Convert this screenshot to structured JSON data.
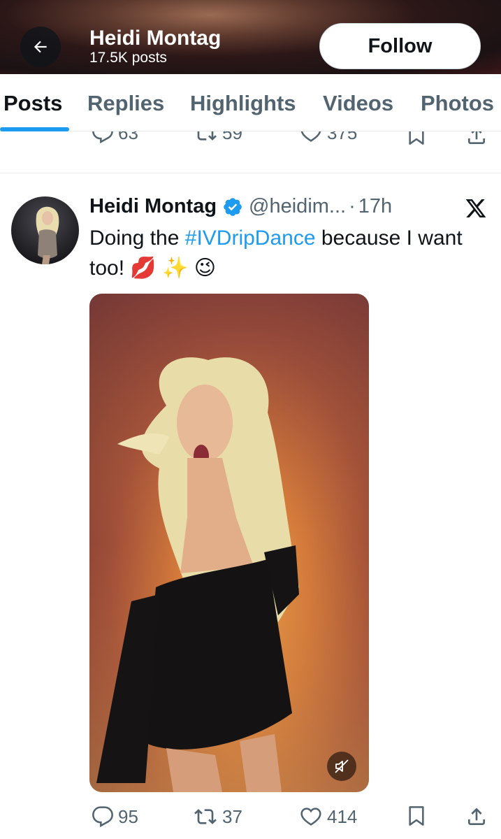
{
  "header": {
    "profile_name": "Heidi Montag",
    "post_count": "17.5K posts",
    "follow_label": "Follow"
  },
  "tabs": [
    {
      "label": "Posts",
      "active": true
    },
    {
      "label": "Replies",
      "active": false
    },
    {
      "label": "Highlights",
      "active": false
    },
    {
      "label": "Videos",
      "active": false
    },
    {
      "label": "Photos",
      "active": false
    }
  ],
  "previous_post": {
    "replies": "63",
    "reposts": "59",
    "likes": "375"
  },
  "post": {
    "author_name": "Heidi Montag",
    "handle": "@heidim...",
    "separator": "·",
    "time": "17h",
    "text_before": "Doing the ",
    "hashtag": "#IVDripDance",
    "text_after": " because I want too! 💋 ✨ 😉",
    "replies": "95",
    "reposts": "37",
    "likes": "414"
  },
  "colors": {
    "accent": "#1d9bf0",
    "text_primary": "#0f1419",
    "text_secondary": "#536471"
  },
  "icons": [
    "back-arrow-icon",
    "verified-badge-icon",
    "x-logo-icon",
    "reply-icon",
    "repost-icon",
    "like-icon",
    "bookmark-icon",
    "share-icon",
    "mute-icon"
  ]
}
